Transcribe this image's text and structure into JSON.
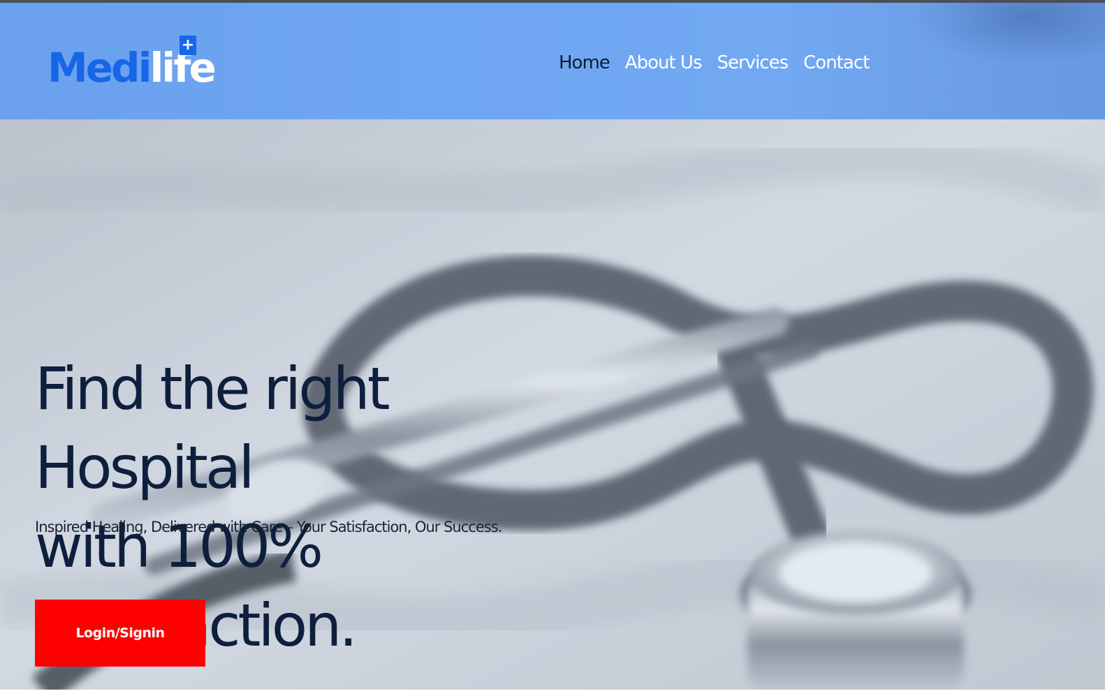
{
  "brand": {
    "logo_part1": "Medi",
    "logo_part2": "life",
    "logo_plus": "+",
    "primary_color": "#1766e8",
    "header_color": "#6fa6f1"
  },
  "nav": {
    "items": [
      {
        "label": "Home",
        "active": true
      },
      {
        "label": "About Us",
        "active": false
      },
      {
        "label": "Services",
        "active": false
      },
      {
        "label": "Contact",
        "active": false
      }
    ]
  },
  "hero": {
    "headline_line1": "Find the right Hospital",
    "headline_line2": "with 100% satisfaction.",
    "tagline": "Inspired Healing, Delivered with Care – Your Satisfaction, Our Success.",
    "background_image": "stethoscope-photo",
    "cta_label": "Login/Signin",
    "cta_color": "#ff0000"
  }
}
